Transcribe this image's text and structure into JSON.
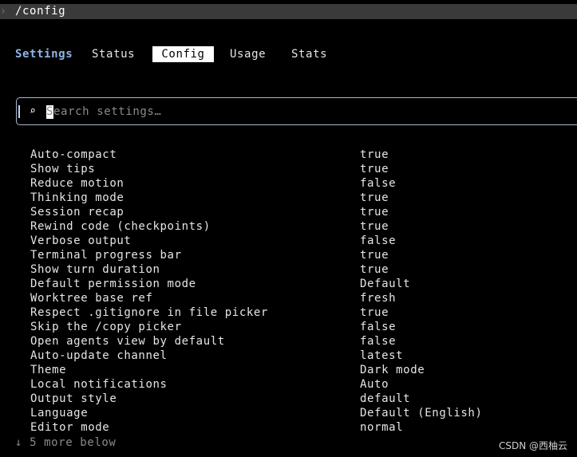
{
  "prompt": {
    "chevron": "›",
    "command": "/config"
  },
  "tabs": {
    "title": "Settings",
    "items": [
      "Status",
      "Config",
      "Usage",
      "Stats"
    ],
    "selected": "Config"
  },
  "search": {
    "icon": "⌕",
    "placeholder": "Search settings…"
  },
  "settings": [
    {
      "name": "Auto-compact",
      "value": "true"
    },
    {
      "name": "Show tips",
      "value": "true"
    },
    {
      "name": "Reduce motion",
      "value": "false"
    },
    {
      "name": "Thinking mode",
      "value": "true"
    },
    {
      "name": "Session recap",
      "value": "true"
    },
    {
      "name": "Rewind code (checkpoints)",
      "value": "true"
    },
    {
      "name": "Verbose output",
      "value": "false"
    },
    {
      "name": "Terminal progress bar",
      "value": "true"
    },
    {
      "name": "Show turn duration",
      "value": "true"
    },
    {
      "name": "Default permission mode",
      "value": "Default"
    },
    {
      "name": "Worktree base ref",
      "value": "fresh"
    },
    {
      "name": "Respect .gitignore in file picker",
      "value": "true"
    },
    {
      "name": "Skip the /copy picker",
      "value": "false"
    },
    {
      "name": "Open agents view by default",
      "value": "false"
    },
    {
      "name": "Auto-update channel",
      "value": "latest"
    },
    {
      "name": "Theme",
      "value": "Dark mode"
    },
    {
      "name": "Local notifications",
      "value": "Auto"
    },
    {
      "name": "Output style",
      "value": "default"
    },
    {
      "name": "Language",
      "value": "Default (English)"
    },
    {
      "name": "Editor mode",
      "value": "normal"
    }
  ],
  "footer": {
    "arrow": "↓",
    "more_text": "5 more below"
  },
  "watermark": "CSDN @西柚云",
  "colors": {
    "background": "#000000",
    "prompt_bar": "#3a3a3a",
    "title_accent": "#8fb4e8",
    "selected_tab_bg": "#ffffff",
    "dim_text": "#8a8a8a"
  }
}
